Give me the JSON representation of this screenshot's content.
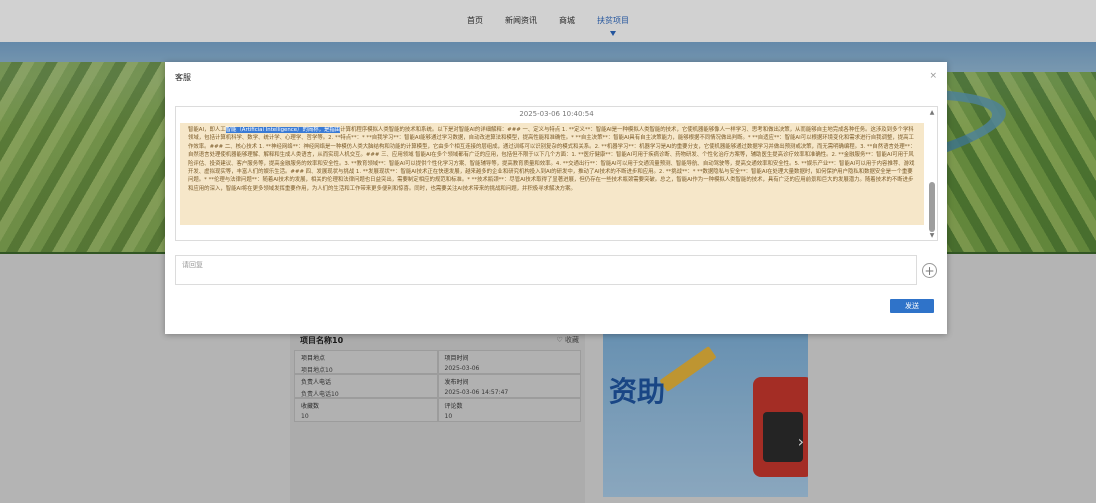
{
  "nav": {
    "items": [
      {
        "label": "首页",
        "active": false
      },
      {
        "label": "新闻资讯",
        "active": false
      },
      {
        "label": "商城",
        "active": false
      },
      {
        "label": "扶贫项目",
        "active": true
      }
    ]
  },
  "card": {
    "title": "项目名称10",
    "favorite_label": "收藏",
    "fields": [
      {
        "key": "项目地点",
        "value": "项目地点10"
      },
      {
        "key": "项目时间",
        "value": "2025-03-06"
      },
      {
        "key": "负责人电话",
        "value": "负责人电话10"
      },
      {
        "key": "发布时间",
        "value": "2025-03-06 14:57:47"
      },
      {
        "key": "收藏数",
        "value": "10"
      },
      {
        "key": "评论数",
        "value": "10"
      }
    ]
  },
  "poster": {
    "text": "资助"
  },
  "modal": {
    "title": "客服",
    "close_icon": "×",
    "timestamp": "2025-03-06 10:40:54",
    "message_prefix": "智能AI，即人工",
    "message_highlight": "智能（Artificial Intelligence）的简称，是指由",
    "message_body": "计算机程序模拟人类智能的技术和系统。以下是对智能AI的详细解释：### 一、定义与特点 1. **定义**：智能AI是一种模拟人类智能的技术，它使机器能够像人一样学习、思考和做出决策，从而能够自主地完成各种任务。这涉及到多个学科领域，包括计算机科学、数学、统计学、心理学、哲学等。2. **特点**：* **自我学习**：智能AI能够通过学习数据，自动改进算法和模型，提高性能和准确性。* **自主决策**：智能AI具有自主决策能力，能够根据不同情况做出判断。* **自适应**：智能AI可以根据环境变化和需求进行自我调整，提高工作效率。### 二、核心技术 1. **神经网络**：神经网络是一种模仿人类大脑结构和功能的计算模型，它由多个相互连接的层组成，通过训练可以识别复杂的模式和关系。2. **机器学习**：机器学习是AI的重要分支，它使机器能够通过数据学习并做出预测或决策，而无需明确编程。3. **自然语言处理**：自然语言处理使机器能够理解、解释和生成人类语言，从而实现人机交互。### 三、应用领域 智能AI在多个领域都有广泛的应用，包括但不限于以下几个方面：1. **医疗健康**：智能AI可用于疾病诊断、药物研发、个性化治疗方案等，辅助医生提高诊疗效率和准确性。2. **金融服务**：智能AI可用于风险评估、投资建议、客户服务等，提高金融服务的效率和安全性。3. **教育领域**：智能AI可以提供个性化学习方案、智能辅导等，提高教育质量和效率。4. **交通出行**：智能AI可以用于交通流量预测、智能导航、自动驾驶等，提高交通效率和安全性。5. **娱乐产业**：智能AI可以用于内容推荐、游戏开发、虚拟现实等，丰富人们的娱乐生活。### 四、发展现状与挑战 1. **发展现状**：智能AI技术正在快速发展，越来越多的企业和研究机构投入到AI的研发中，推动了AI技术的不断进步和应用。2. **挑战**：* **数据隐私与安全**：智能AI在处理大量数据时，如何保护用户隐私和数据安全是一个重要问题。* **伦理与法律问题**：随着AI技术的发展，相关的伦理和法律问题也日益突出，需要制定相应的规范和标准。* **技术瓶颈**：尽管AI技术取得了显著进展，但仍存在一些技术瓶颈需要突破。总之，智能AI作为一种模拟人类智能的技术，具有广泛的应用前景和巨大的发展潜力。随着技术的不断进步和应用的深入，智能AI将在更多领域发挥重要作用，为人们的生活和工作带来更多便利和惊喜。同时，也需要关注AI技术带来的挑战和问题，并积极寻求解决方案。",
    "reply_placeholder": "请回复",
    "add_icon": "+",
    "send_label": "发送"
  }
}
